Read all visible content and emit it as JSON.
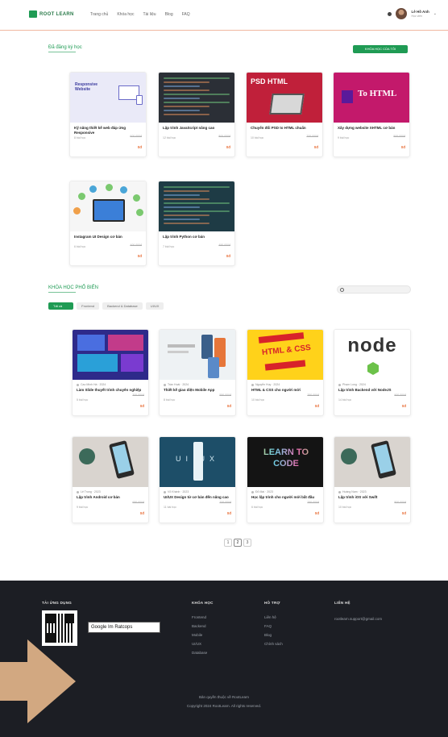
{
  "header": {
    "logo_text": "ROOT LEARN",
    "nav": [
      "Trang chủ",
      "Khóa học",
      "Tài liệu",
      "Blog",
      "FAQ"
    ],
    "user": {
      "name": "Lê Hồ Anh",
      "role": "Học viên"
    }
  },
  "sections": {
    "registered": {
      "title": "Đã đăng ký học",
      "button": "KHÓA HỌC CỦA TÔI"
    },
    "popular": {
      "title": "KHÓA HỌC PHỔ BIẾN",
      "search_placeholder": "Tìm kiếm khóa học..."
    }
  },
  "registered_courses": [
    {
      "title": "Kỹ năng thiết kế web đáp ứng Responsive",
      "lessons": "8 bài học",
      "old_price": "600.000đ",
      "price": "0đ",
      "thumb_text": "Responsive Website"
    },
    {
      "title": "Lập trình JavaScript nâng cao",
      "lessons": "12 bài học",
      "old_price": "800.000đ",
      "price": "0đ",
      "thumb_text": ""
    },
    {
      "title": "Chuyển đổi PSD to HTML chuẩn",
      "lessons": "10 bài học",
      "old_price": "700.000đ",
      "price": "0đ",
      "thumb_text": "PSD HTML"
    },
    {
      "title": "Xây dựng website XHTML cơ bản",
      "lessons": "9 bài học",
      "old_price": "500.000đ",
      "price": "0đ",
      "thumb_text": "To HTML"
    },
    {
      "title": "Instagram UI Design cơ bản",
      "lessons": "6 bài học",
      "old_price": "400.000đ",
      "price": "0đ",
      "thumb_text": ""
    },
    {
      "title": "Lập trình Python cơ bản",
      "lessons": "7 bài học",
      "old_price": "450.000đ",
      "price": "0đ",
      "thumb_text": ""
    }
  ],
  "filters": [
    {
      "label": "Tất cả",
      "active": true
    },
    {
      "label": "Frontend",
      "active": false
    },
    {
      "label": "Backend & Database",
      "active": false
    },
    {
      "label": "UI/UX",
      "active": false
    }
  ],
  "popular_courses": [
    {
      "meta": "Cao Minh Hà · 2024",
      "title": "Làm Slide thuyết trình chuyên nghiệp",
      "lessons": "5 bài học",
      "old_price": "300.000đ",
      "price": "0đ",
      "thumb_text": ""
    },
    {
      "meta": "Trần Hoài · 2024",
      "title": "Thiết kế giao diện Mobile App",
      "lessons": "8 bài học",
      "old_price": "550.000đ",
      "price": "0đ",
      "thumb_text": ""
    },
    {
      "meta": "Nguyễn Huy · 2024",
      "title": "HTML & CSS cho người mới",
      "lessons": "10 bài học",
      "old_price": "350.000đ",
      "price": "0đ",
      "thumb_text": "HTML & CSS"
    },
    {
      "meta": "Phạm Long · 2024",
      "title": "Lập trình Backend với NodeJS",
      "lessons": "14 bài học",
      "old_price": "900.000đ",
      "price": "0đ",
      "thumb_text": "node"
    },
    {
      "meta": "Lê Trung · 2023",
      "title": "Lập trình Android cơ bản",
      "lessons": "9 bài học",
      "old_price": "650.000đ",
      "price": "0đ",
      "thumb_text": ""
    },
    {
      "meta": "Võ Khánh · 2023",
      "title": "UI/UX Design từ cơ bản đến nâng cao",
      "lessons": "11 bài học",
      "old_price": "700.000đ",
      "price": "0đ",
      "thumb_text": "UI UX"
    },
    {
      "meta": "Đỗ Mai · 2023",
      "title": "Học lập trình cho người mới bắt đầu",
      "lessons": "6 bài học",
      "old_price": "250.000đ",
      "price": "0đ",
      "thumb_text": "LEARN TO CODE"
    },
    {
      "meta": "Hoàng Nam · 2023",
      "title": "Lập trình iOS với Swift",
      "lessons": "10 bài học",
      "old_price": "800.000đ",
      "price": "0đ",
      "thumb_text": ""
    }
  ],
  "pagination": [
    "1",
    "2",
    "3"
  ],
  "footer": {
    "app_title": "TẢI ỨNG DỤNG",
    "google_play": "Google Im Ratcops",
    "col1": {
      "title": "KHÓA HỌC",
      "links": [
        "Frontend",
        "Backend",
        "Mobile",
        "UI/UX",
        "Database"
      ]
    },
    "col2": {
      "title": "HỖ TRỢ",
      "links": [
        "Liên hệ",
        "FAQ",
        "Blog",
        "Chính sách"
      ]
    },
    "col3": {
      "title": "LIÊN HỆ",
      "email": "rootlearn.support@gmail.com"
    },
    "copyright1": "Bản quyền thuộc về RootLearn",
    "copyright2": "Copyright 2024 RootLearn. All rights reserved."
  },
  "colors": {
    "accent": "#1f9b54",
    "price": "#e8703a",
    "footer_bg": "#1c1e24",
    "arrow": "#d2a881"
  }
}
